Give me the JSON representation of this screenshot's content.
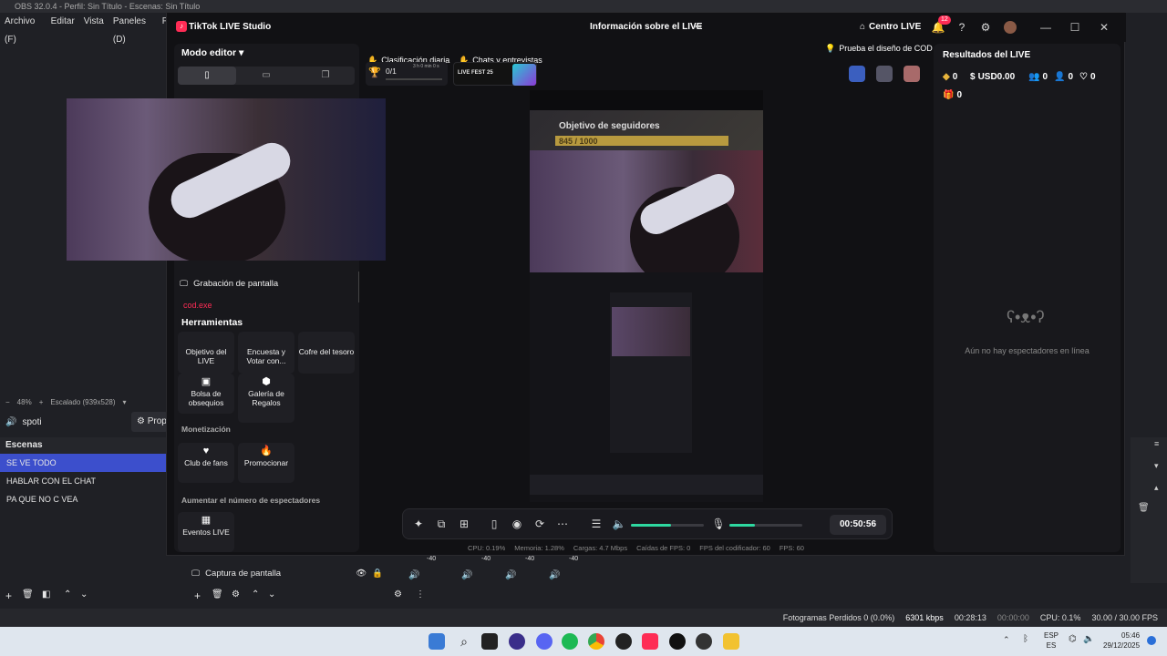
{
  "obs": {
    "title": "OBS 32.0.4 - Perfil: Sin Título - Escenas: Sin Título",
    "menu": [
      "Archivo (F)",
      "Editar",
      "Vista",
      "Paneles (D)",
      "Pe"
    ],
    "zoom": "48%",
    "scaling": "Escalado (939x528)",
    "source_name": "spoti",
    "props_label": "Prop",
    "scenes_title": "Escenas",
    "scenes": [
      "SE VE TODO",
      "HABLAR CON EL CHAT",
      "PA QUE NO C VEA"
    ],
    "source_row": "Captura de pantalla",
    "mixer_db": [
      "-40",
      "-40",
      "-40",
      "-40"
    ],
    "status": {
      "dropped": "Fotogramas Perdidos 0 (0.0%)",
      "kbps": "6301 kbps",
      "rec_time": "00:28:13",
      "rec_idle": "00:00:00",
      "cpu": "CPU: 0.1%",
      "fps": "30.00 / 30.00 FPS"
    }
  },
  "tiktok": {
    "app_title": "TikTok LIVE Studio",
    "center_title": "Información sobre el LIVE",
    "centro_live": "Centro LIVE",
    "notif_count": "12",
    "mode_editor": "Modo editor",
    "source_grab": "Grabación de pantalla",
    "source_cod": "cod.exe",
    "tools_title": "Herramientas",
    "tools": [
      {
        "label": "Objetivo del LIVE",
        "icon": "flag-icon"
      },
      {
        "label": "Encuesta y Votar con...",
        "icon": "poll-icon"
      },
      {
        "label": "Cofre del tesoro",
        "icon": "chest-icon"
      },
      {
        "label": "Bolsa de obsequios",
        "icon": "gift-bag-icon"
      },
      {
        "label": "Galería de Regalos",
        "icon": "gift-gallery-icon"
      }
    ],
    "monetization_title": "Monetización",
    "monetization": [
      {
        "label": "Club de fans",
        "icon": "heart-icon"
      },
      {
        "label": "Promocionar",
        "icon": "flame-icon"
      }
    ],
    "increase_title": "Aumentar el número de espectadores",
    "events_label": "Eventos LIVE",
    "chip_daily": "Clasificación diaria",
    "chip_chats": "Chats y entrevistas",
    "daily_progress": "0/1",
    "daily_time": "3 h 0 min 0 s",
    "livefest": "LIVE FEST 25",
    "design_tip": "Prueba el diseño de COD",
    "goal_title": "Objetivo de seguidores",
    "goal_progress": "845 / 1000",
    "timer": "00:50:56",
    "status": {
      "cpu": "CPU: 0.19%",
      "mem": "Memoria: 1.28%",
      "load": "Cargas: 4.7 Mbps",
      "fps_drops": "Caídas de FPS: 0",
      "enc_fps": "FPS del codificador: 60",
      "fps": "FPS: 60"
    },
    "results_title": "Resultados del LIVE",
    "stats": {
      "diamonds": "0",
      "usd": "USD0.00",
      "viewers": "0",
      "followers": "0",
      "likes": "0",
      "gifts": "0"
    },
    "no_viewers": "Aún no hay espectadores en línea",
    "volume_level": 0.55,
    "mic_level": 0.35
  },
  "taskbar": {
    "time": "05:46",
    "date": "29/12/2025",
    "lang1": "ESP",
    "lang2": "ES"
  },
  "colors": {
    "accent": "#fe2c55",
    "obs_selected": "#3c4fcc",
    "green": "#2ed8a0"
  }
}
